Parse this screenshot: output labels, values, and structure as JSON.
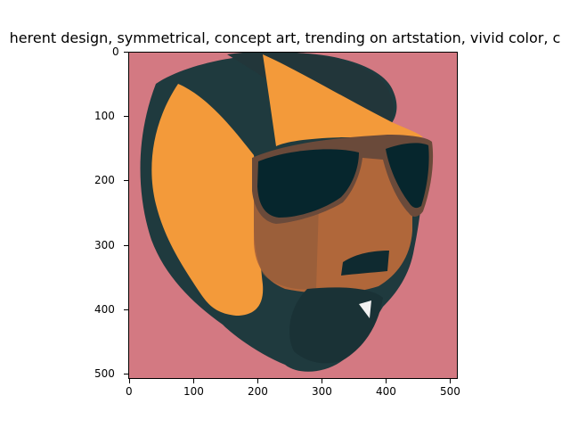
{
  "title": "herent design, symmetrical,  concept art, trending on artstation, vivid color, c",
  "image_description_icon": "stylized-face-with-aviator-sunglasses",
  "colors": {
    "background": "#d37982",
    "orange": "#f39a3a",
    "dark": "#1f3a3e",
    "brown": "#b0673a",
    "lens": "#06262d"
  },
  "axes": {
    "x_ticks": [
      "0",
      "100",
      "200",
      "300",
      "400",
      "500"
    ],
    "y_ticks": [
      "0",
      "100",
      "200",
      "300",
      "400",
      "500"
    ]
  }
}
